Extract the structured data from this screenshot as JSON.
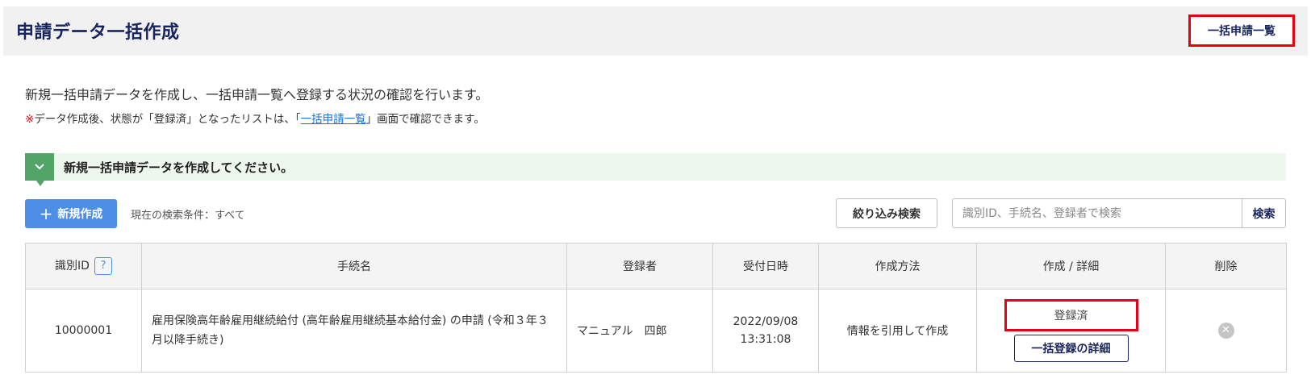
{
  "header": {
    "title": "申請データ一括作成",
    "list_button": "一括申請一覧"
  },
  "description": {
    "line1": "新規一括申請データを作成し、一括申請一覧へ登録する状況の確認を行います。",
    "note_mark": "※",
    "note_prefix": "データ作成後、状態が「登録済」となったリストは、「",
    "note_link": "一括申請一覧",
    "note_suffix": "」画面で確認できます。"
  },
  "section": {
    "icon": "chevron-down-icon",
    "label": "新規一括申請データを作成してください。"
  },
  "toolbar": {
    "new_button": "新規作成",
    "new_icon": "plus-icon",
    "condition_text": "現在の検索条件：すべて",
    "filter_button": "絞り込み検索",
    "search_placeholder": "識別ID、手続名、登録者で検索",
    "search_button": "検索"
  },
  "table": {
    "headers": {
      "id": "識別ID",
      "help": "?",
      "procedure": "手続名",
      "registrant": "登録者",
      "received": "受付日時",
      "method": "作成方法",
      "create_detail": "作成 / 詳細",
      "delete": "削除"
    },
    "rows": [
      {
        "id": "10000001",
        "procedure": "雇用保険高年齢雇用継続給付 (高年齢雇用継続基本給付金) の申請 (令和３年３月以降手続き)",
        "registrant": "マニュアル　四郎",
        "received_date": "2022/09/08",
        "received_time": "13:31:08",
        "method": "情報を引用して作成",
        "status": "登録済",
        "detail_button": "一括登録の詳細",
        "delete_icon": "close-circle-icon"
      }
    ]
  },
  "colors": {
    "title": "#17245e",
    "highlight": "#e60012",
    "primary_button": "#4d8fe6",
    "section_icon": "#52a567",
    "section_bg": "#eef7ee",
    "link": "#1a6fd6"
  }
}
